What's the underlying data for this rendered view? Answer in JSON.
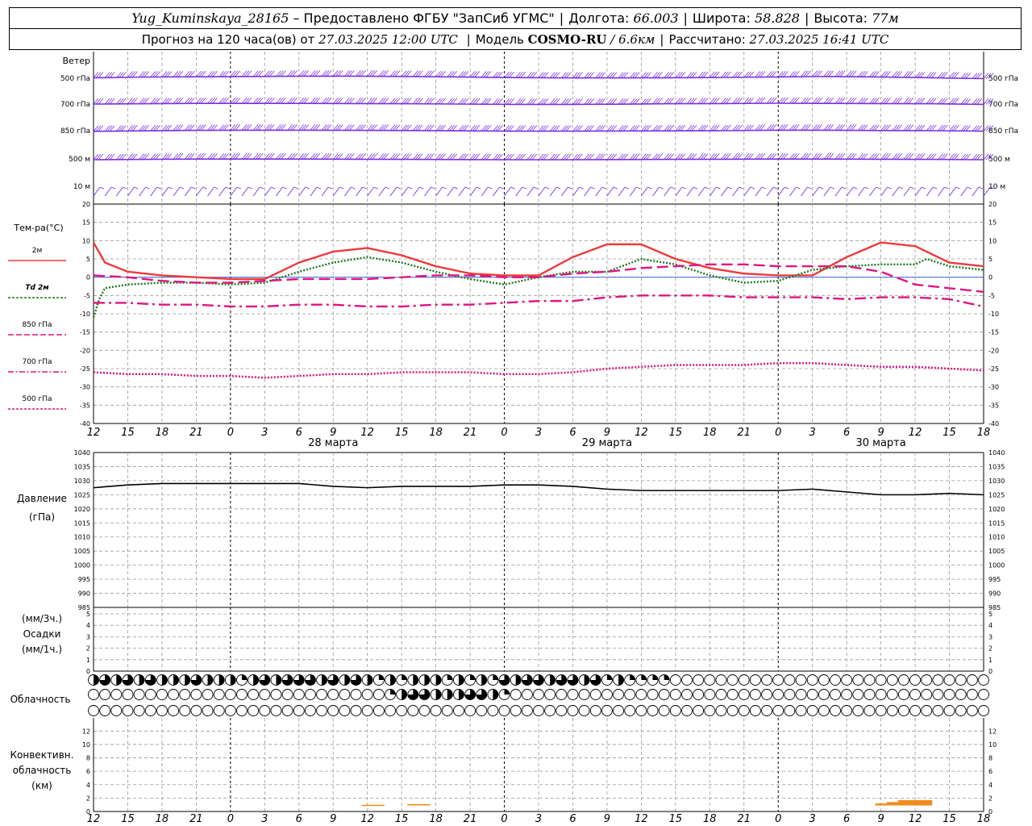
{
  "header": {
    "station": "Yug_Kuminskaya_28165",
    "provider": "– Предоставлено ФГБУ \"ЗапСиб УГМС\"",
    "lon_label": "Долгота:",
    "lon_value": "66.003",
    "lat_label": "Широта:",
    "lat_value": "58.828",
    "alt_label": "Высота:",
    "alt_value": "77м",
    "forecast_prefix": "Прогноз на 120 часа(ов) от",
    "forecast_time": "27.03.2025 12:00 UTC",
    "model_label": "Модель",
    "model_name": "COSMO-RU",
    "model_res": "/ 6.6км",
    "computed_label": "Рассчитано:",
    "computed_time": "27.03.2025 16:41 UTC"
  },
  "labels": {
    "wind": "Ветер",
    "wind_levels": [
      "500 гПа",
      "700 гПа",
      "850 гПа",
      "500 м",
      "10 м"
    ],
    "temp_title": "Тем-ра(°C)",
    "temp_legend": [
      "2м",
      "Td 2м",
      "850 гПа",
      "700 гПа",
      "500 гПа"
    ],
    "pressure_title": "Давление",
    "pressure_unit": "(гПа)",
    "precip_3h": "(мм/3ч.)",
    "precip_title": "Осадки",
    "precip_1h": "(мм/1ч.)",
    "cloud_title": "Облачность",
    "conv_title_1": "Конвективн.",
    "conv_title_2": "облачность",
    "conv_unit": "(км)"
  },
  "colors": {
    "t2m": "#ee3b3b",
    "td2m": "#1a7a1a",
    "t850": "#e0157f",
    "t700": "#e0157f",
    "t500": "#e0157f",
    "pressure": "#000000",
    "wind": "#7b2ee0",
    "conv": "#f08c1e",
    "grid": "#9a9a9a"
  },
  "axis": {
    "hour_ticks": [
      "12",
      "15",
      "18",
      "21",
      "0",
      "3",
      "6",
      "9",
      "12",
      "15",
      "18",
      "21",
      "0",
      "3",
      "6",
      "9",
      "12",
      "15",
      "18",
      "21",
      "0",
      "3",
      "6",
      "9",
      "12",
      "15",
      "18"
    ],
    "day_labels": [
      {
        "text": "28 марта",
        "at_h": 21
      },
      {
        "text": "29 марта",
        "at_h": 45
      },
      {
        "text": "30 марта",
        "at_h": 69
      }
    ],
    "midnight_h": [
      12,
      36,
      60
    ]
  },
  "chart_data": {
    "type": "line",
    "x_unit": "hours from 27.03.2025 12:00 UTC",
    "x_range": [
      0,
      78
    ],
    "temperature": {
      "ylim": [
        -40,
        20
      ],
      "ticks": [
        20,
        15,
        10,
        5,
        0,
        -5,
        -10,
        -15,
        -20,
        -25,
        -30,
        -35,
        -40
      ],
      "series": [
        {
          "key": "t2m",
          "name": "2м",
          "style": "solid",
          "x": [
            0,
            1,
            3,
            6,
            9,
            12,
            15,
            18,
            21,
            24,
            27,
            30,
            33,
            36,
            39,
            42,
            45,
            48,
            51,
            54,
            57,
            60,
            63,
            66,
            69,
            72,
            75,
            78
          ],
          "y": [
            9.5,
            4,
            1.5,
            0.5,
            0,
            -0.5,
            -0.5,
            4,
            7,
            8,
            6,
            3,
            1,
            0.5,
            0.5,
            5.5,
            9,
            9,
            5,
            2.5,
            1,
            0.5,
            0.5,
            5.5,
            9.5,
            8.5,
            4,
            3
          ]
        },
        {
          "key": "td2m",
          "name": "Td 2м",
          "style": "dotted",
          "x": [
            0,
            0.5,
            1,
            3,
            6,
            9,
            12,
            15,
            18,
            21,
            24,
            27,
            30,
            33,
            36,
            39,
            42,
            45,
            48,
            51,
            54,
            57,
            60,
            63,
            66,
            69,
            72,
            73,
            75,
            78
          ],
          "y": [
            -11,
            -6,
            -3,
            -2,
            -1.5,
            -1.5,
            -2,
            -1.5,
            1.5,
            4,
            5.5,
            4,
            1.5,
            -0.5,
            -2,
            0,
            1.5,
            1.5,
            5,
            3.5,
            0.5,
            -1.5,
            -1,
            2,
            3,
            3.5,
            3.5,
            5,
            3,
            2
          ]
        },
        {
          "key": "t850",
          "name": "850 гПа",
          "style": "dashed",
          "x": [
            0,
            3,
            6,
            9,
            12,
            15,
            18,
            21,
            24,
            27,
            30,
            33,
            36,
            39,
            42,
            45,
            48,
            51,
            54,
            57,
            60,
            63,
            66,
            69,
            72,
            75,
            78
          ],
          "y": [
            0.5,
            0,
            -1,
            -1.5,
            -1.5,
            -1,
            -0.5,
            -0.5,
            -0.5,
            0,
            0.5,
            0.5,
            0,
            0,
            1,
            1.5,
            2.5,
            3,
            3.5,
            3.5,
            3,
            3,
            3,
            1.5,
            -2,
            -3,
            -4
          ]
        },
        {
          "key": "t700",
          "name": "700 гПа",
          "style": "dashdot",
          "x": [
            0,
            3,
            6,
            9,
            12,
            15,
            18,
            21,
            24,
            27,
            30,
            33,
            36,
            39,
            42,
            45,
            48,
            51,
            54,
            57,
            60,
            63,
            66,
            69,
            72,
            75,
            78
          ],
          "y": [
            -7,
            -7,
            -7.5,
            -7.5,
            -8,
            -8,
            -7.5,
            -7.5,
            -8,
            -8,
            -7.5,
            -7.5,
            -7,
            -6.5,
            -6.5,
            -5.5,
            -5,
            -5,
            -5,
            -5.5,
            -5.5,
            -5.5,
            -6,
            -5.5,
            -5.5,
            -6,
            -8
          ]
        },
        {
          "key": "t500",
          "name": "500 гПа",
          "style": "dotted",
          "x": [
            0,
            3,
            6,
            9,
            12,
            15,
            18,
            21,
            24,
            27,
            30,
            33,
            36,
            39,
            42,
            45,
            48,
            51,
            54,
            57,
            60,
            63,
            66,
            69,
            72,
            75,
            78
          ],
          "y": [
            -26,
            -26.5,
            -26.5,
            -27,
            -27,
            -27.5,
            -27,
            -26.5,
            -26.5,
            -26,
            -26,
            -26,
            -26.5,
            -26.5,
            -26,
            -25,
            -24.5,
            -24,
            -24,
            -24,
            -23.5,
            -23.5,
            -24,
            -24.5,
            -24.5,
            -25,
            -25.5
          ]
        }
      ]
    },
    "pressure": {
      "ylim": [
        985,
        1040
      ],
      "ticks": [
        1040,
        1035,
        1030,
        1025,
        1020,
        1015,
        1010,
        1005,
        1000,
        995,
        990,
        985
      ],
      "series": [
        {
          "key": "pressure",
          "style": "solid",
          "x": [
            0,
            3,
            6,
            9,
            12,
            15,
            18,
            21,
            24,
            27,
            30,
            33,
            36,
            39,
            42,
            45,
            48,
            51,
            54,
            57,
            60,
            63,
            66,
            69,
            72,
            75,
            78
          ],
          "y": [
            1027.5,
            1028.5,
            1029,
            1029,
            1029,
            1029,
            1029,
            1028,
            1027.5,
            1028,
            1028,
            1028,
            1028.5,
            1028.5,
            1028,
            1027,
            1026.5,
            1026.5,
            1026.5,
            1026.5,
            1026.5,
            1027,
            1026,
            1025,
            1025,
            1025.5,
            1025
          ]
        }
      ]
    },
    "precipitation": {
      "ylim": [
        0,
        5
      ],
      "ticks": [
        5,
        4,
        3,
        2,
        1,
        0
      ],
      "values": []
    },
    "convective_cloud_km": {
      "ylim": [
        0,
        13
      ],
      "ticks": [
        12,
        10,
        8,
        6,
        4,
        2,
        0
      ],
      "bars": [
        {
          "x0": 23.5,
          "x1": 25.5,
          "bottom": 0.9,
          "top": 1.0
        },
        {
          "x0": 27.5,
          "x1": 29.5,
          "bottom": 0.9,
          "top": 1.1
        },
        {
          "x0": 68.5,
          "x1": 69.5,
          "bottom": 0.9,
          "top": 1.2
        },
        {
          "x0": 69.5,
          "x1": 70.5,
          "bottom": 0.9,
          "top": 1.4
        },
        {
          "x0": 70.5,
          "x1": 73.5,
          "bottom": 0.9,
          "top": 1.7
        }
      ]
    },
    "cloud_cover": {
      "rows": [
        "high",
        "middle",
        "low"
      ],
      "step_h": 1,
      "fractions": {
        "high": [
          0.5,
          0.75,
          0.5,
          0.75,
          0.5,
          0.75,
          0.5,
          0.5,
          0.5,
          0.75,
          0.5,
          0.5,
          0.5,
          0.25,
          0.5,
          0.75,
          0.5,
          0.75,
          0.75,
          0.75,
          0.5,
          0.75,
          0.5,
          0.75,
          0.5,
          0.25,
          0.5,
          0.25,
          0.5,
          0.5,
          0.5,
          0.25,
          0.5,
          0.25,
          0.5,
          0.25,
          0.75,
          0.5,
          0.75,
          0.75,
          0.5,
          0.75,
          0.75,
          0.5,
          0.75,
          0.25,
          0.5,
          0.25,
          0.25,
          0.25,
          0.25,
          0,
          0,
          0,
          0,
          0,
          0,
          0,
          0,
          0,
          0,
          0,
          0,
          0,
          0,
          0,
          0,
          0,
          0,
          0,
          0,
          0,
          0,
          0,
          0,
          0,
          0,
          0,
          0
        ],
        "middle": [
          0,
          0,
          0,
          0,
          0,
          0,
          0,
          0,
          0,
          0,
          0,
          0,
          0,
          0,
          0,
          0,
          0,
          0,
          0,
          0,
          0,
          0,
          0,
          0,
          0,
          0,
          0.25,
          0.5,
          0.75,
          0.75,
          0.5,
          0.5,
          0.5,
          0.75,
          0.75,
          0.5,
          0.25,
          0,
          0,
          0,
          0,
          0,
          0,
          0,
          0,
          0,
          0,
          0,
          0,
          0,
          0,
          0,
          0,
          0,
          0,
          0,
          0,
          0,
          0,
          0,
          0,
          0,
          0,
          0,
          0,
          0,
          0,
          0,
          0,
          0,
          0,
          0,
          0,
          0,
          0,
          0,
          0,
          0,
          0
        ],
        "low": [
          0,
          0,
          0,
          0,
          0,
          0,
          0,
          0,
          0,
          0,
          0,
          0,
          0,
          0,
          0,
          0,
          0,
          0,
          0,
          0,
          0,
          0,
          0,
          0,
          0,
          0,
          0,
          0,
          0,
          0,
          0,
          0,
          0,
          0,
          0,
          0,
          0,
          0,
          0,
          0,
          0,
          0,
          0,
          0,
          0,
          0,
          0,
          0,
          0,
          0,
          0,
          0,
          0,
          0,
          0,
          0,
          0,
          0,
          0,
          0,
          0,
          0,
          0,
          0,
          0,
          0,
          0,
          0,
          0,
          0,
          0,
          0,
          0,
          0,
          0,
          0,
          0,
          0,
          0
        ]
      }
    },
    "wind_barbs": {
      "levels": [
        "500 гПа",
        "700 гПа",
        "850 гПа",
        "500 м",
        "10 м"
      ],
      "line_y": {
        "500 гПа": [
          2.5,
          3.5,
          3.8,
          4.2,
          4.6,
          4.6,
          4.2,
          3.6,
          2.8,
          2.4,
          2.4,
          2.6,
          3.0,
          3.6,
          4.2,
          3.6,
          2.6,
          1.5
        ],
        "700 гПа": [
          2.0,
          2.4,
          2.8,
          2.8,
          2.8,
          2.6,
          2.4,
          2.0,
          1.6,
          1.6,
          1.8,
          2.4,
          2.6,
          3.0,
          2.8,
          2.6,
          2.4,
          1.6
        ],
        "850 гПа": [
          1.2,
          1.8,
          2.4,
          2.6,
          2.6,
          2.4,
          2.2,
          1.8,
          1.4,
          1.4,
          1.6,
          1.8,
          2.0,
          2.6,
          2.6,
          2.2,
          2.0,
          1.4
        ],
        "500 м": [
          1.0,
          1.4,
          1.8,
          1.8,
          1.8,
          1.6,
          1.4,
          1.2,
          1.0,
          1.0,
          1.2,
          1.4,
          1.6,
          1.8,
          1.8,
          1.6,
          1.4,
          1.0
        ]
      }
    }
  }
}
